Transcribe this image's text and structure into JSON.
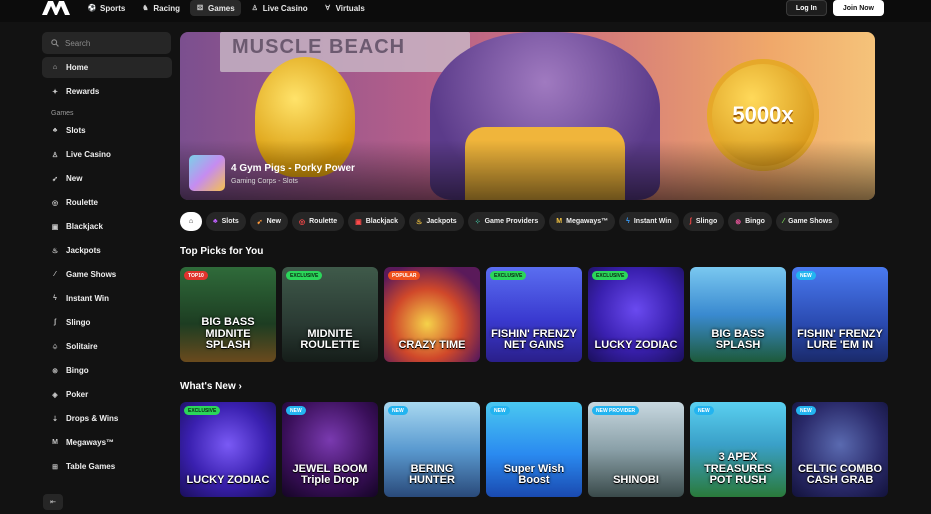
{
  "nav": {
    "items": [
      {
        "label": "Sports",
        "icon": "football-icon",
        "glyph": "⚽",
        "active": false
      },
      {
        "label": "Racing",
        "icon": "horse-icon",
        "glyph": "♞",
        "active": false
      },
      {
        "label": "Games",
        "icon": "dice-icon",
        "glyph": "⚄",
        "active": true
      },
      {
        "label": "Live Casino",
        "icon": "dealer-icon",
        "glyph": "♙",
        "active": false
      },
      {
        "label": "Virtuals",
        "icon": "virtuals-icon",
        "glyph": "∀",
        "active": false
      }
    ],
    "login_label": "Log In",
    "join_label": "Join Now"
  },
  "sidebar": {
    "search_placeholder": "Search",
    "top_items": [
      {
        "label": "Home",
        "icon": "home-icon",
        "glyph": "⌂",
        "active": true
      },
      {
        "label": "Rewards",
        "icon": "gift-icon",
        "glyph": "✦",
        "active": false
      }
    ],
    "games_heading": "Games",
    "items": [
      {
        "label": "Slots",
        "icon": "slots-icon",
        "glyph": "♣"
      },
      {
        "label": "Live Casino",
        "icon": "dealer-icon",
        "glyph": "♙"
      },
      {
        "label": "New",
        "icon": "rocket-icon",
        "glyph": "➹"
      },
      {
        "label": "Roulette",
        "icon": "roulette-icon",
        "glyph": "◎"
      },
      {
        "label": "Blackjack",
        "icon": "cards-icon",
        "glyph": "▣"
      },
      {
        "label": "Jackpots",
        "icon": "moneybag-icon",
        "glyph": "♨"
      },
      {
        "label": "Game Shows",
        "icon": "microphone-icon",
        "glyph": "⁄"
      },
      {
        "label": "Instant Win",
        "icon": "lightning-icon",
        "glyph": "ϟ"
      },
      {
        "label": "Slingo",
        "icon": "slingo-icon",
        "glyph": "ʃ"
      },
      {
        "label": "Solitaire",
        "icon": "solitaire-icon",
        "glyph": "♤"
      },
      {
        "label": "Bingo",
        "icon": "bingo-icon",
        "glyph": "⊚"
      },
      {
        "label": "Poker",
        "icon": "poker-icon",
        "glyph": "◈"
      },
      {
        "label": "Drops & Wins",
        "icon": "drops-icon",
        "glyph": "⇣"
      },
      {
        "label": "Megaways™",
        "icon": "megaways-icon",
        "glyph": "M"
      },
      {
        "label": "Table Games",
        "icon": "table-icon",
        "glyph": "⊞"
      }
    ]
  },
  "hero": {
    "title": "4 Gym Pigs - Porky Power",
    "subtitle": "Gaming Corps - Slots",
    "sign_text": "MUSCLE BEACH",
    "coin_text": "5000x"
  },
  "chips": [
    {
      "label": "Slots",
      "glyph": "♣",
      "icon": "slots-icon",
      "color": "#c060ff"
    },
    {
      "label": "New",
      "glyph": "➹",
      "icon": "rocket-icon",
      "color": "#ff9a3a"
    },
    {
      "label": "Roulette",
      "glyph": "◎",
      "icon": "roulette-icon",
      "color": "#ff4a4a"
    },
    {
      "label": "Blackjack",
      "glyph": "▣",
      "icon": "cards-icon",
      "color": "#ff4a4a"
    },
    {
      "label": "Jackpots",
      "glyph": "♨",
      "icon": "moneybag-icon",
      "color": "#f5c542"
    },
    {
      "label": "Game Providers",
      "glyph": "⁘",
      "icon": "providers-icon",
      "color": "#45d6b0"
    },
    {
      "label": "Megaways™",
      "glyph": "M",
      "icon": "megaways-icon",
      "color": "#f5c542"
    },
    {
      "label": "Instant Win",
      "glyph": "ϟ",
      "icon": "lightning-icon",
      "color": "#3aa0ff"
    },
    {
      "label": "Slingo",
      "glyph": "ʃ",
      "icon": "slingo-icon",
      "color": "#ff4a4a"
    },
    {
      "label": "Bingo",
      "glyph": "⊚",
      "icon": "bingo-icon",
      "color": "#ff5aa8"
    },
    {
      "label": "Game Shows",
      "glyph": "⁄",
      "icon": "microphone-icon",
      "color": "#7ee05a"
    }
  ],
  "top_picks": {
    "title": "Top Picks for You",
    "tiles": [
      {
        "name": "BIG BASS MIDNITE SPLASH",
        "badge": "TOP10",
        "badge_type": "top10",
        "bg": "linear-gradient(180deg,#2f6b3a,#1d3d22 60%,#6a4a1d)"
      },
      {
        "name": "MIDNITE ROULETTE",
        "badge": "EXCLUSIVE",
        "badge_type": "exclusive",
        "bg": "linear-gradient(180deg,#3f5a4a,#2a3a33 60%,#151d19)"
      },
      {
        "name": "CRAZY TIME",
        "badge": "POPULAR",
        "badge_type": "popular",
        "bg": "radial-gradient(circle at 45% 60%,#f5d24a,#d0482a 45%,#5a1a5a 80%)"
      },
      {
        "name": "FISHIN' FRENZY NET GAINS",
        "badge": "EXCLUSIVE",
        "badge_type": "exclusive",
        "bg": "linear-gradient(180deg,#5a6ef0,#3a3ad0 55%,#2a1f8a)"
      },
      {
        "name": "LUCKY ZODIAC",
        "badge": "EXCLUSIVE",
        "badge_type": "exclusive",
        "bg": "radial-gradient(circle at 50% 45%,#6a4af0,#3a20b0 55%,#1a0f5a)"
      },
      {
        "name": "BIG BASS SPLASH",
        "badge": "",
        "badge_type": "",
        "bg": "linear-gradient(180deg,#7ac8f0,#3a8ad0 50%,#1d5a3a)"
      },
      {
        "name": "FISHIN' FRENZY LURE 'EM IN",
        "badge": "NEW",
        "badge_type": "new",
        "bg": "linear-gradient(180deg,#4a7af0,#2a4ab0 60%,#1a2a6a)"
      }
    ]
  },
  "whats_new": {
    "title": "What's New",
    "chevron": "›",
    "tiles": [
      {
        "name": "LUCKY ZODIAC",
        "badge": "EXCLUSIVE",
        "badge_type": "exclusive",
        "bg": "radial-gradient(circle at 50% 45%,#7a5af5,#3a20b0 55%,#1a0f5a)"
      },
      {
        "name": "JEWEL BOOM Triple Drop",
        "badge": "NEW",
        "badge_type": "new",
        "bg": "radial-gradient(circle at 50% 40%,#7a3ab0,#3a0f5a 60%,#140524)"
      },
      {
        "name": "BERING HUNTER",
        "badge": "NEW",
        "badge_type": "new",
        "bg": "linear-gradient(180deg,#a8d8f0,#5a9ad0 50%,#2a4a7a)"
      },
      {
        "name": "Super Wish Boost",
        "badge": "NEW",
        "badge_type": "new",
        "bg": "linear-gradient(180deg,#4ac8f0,#2a8af0 55%,#1a4ab0)"
      },
      {
        "name": "SHINOBI",
        "badge": "NEW PROVIDER",
        "badge_type": "newprovider",
        "bg": "linear-gradient(180deg,#c8d8e0,#8aa0a8 50%,#3a4a4a)"
      },
      {
        "name": "3 APEX TREASURES POT RUSH",
        "badge": "NEW",
        "badge_type": "new",
        "bg": "linear-gradient(180deg,#5ad0f0,#3aa0c8 45%,#2a7a3a)"
      },
      {
        "name": "CELTIC COMBO CASH GRAB",
        "badge": "NEW",
        "badge_type": "new",
        "bg": "radial-gradient(circle at 50% 45%,#5a6ab0,#2a2a6a 60%,#12123a)"
      }
    ]
  }
}
